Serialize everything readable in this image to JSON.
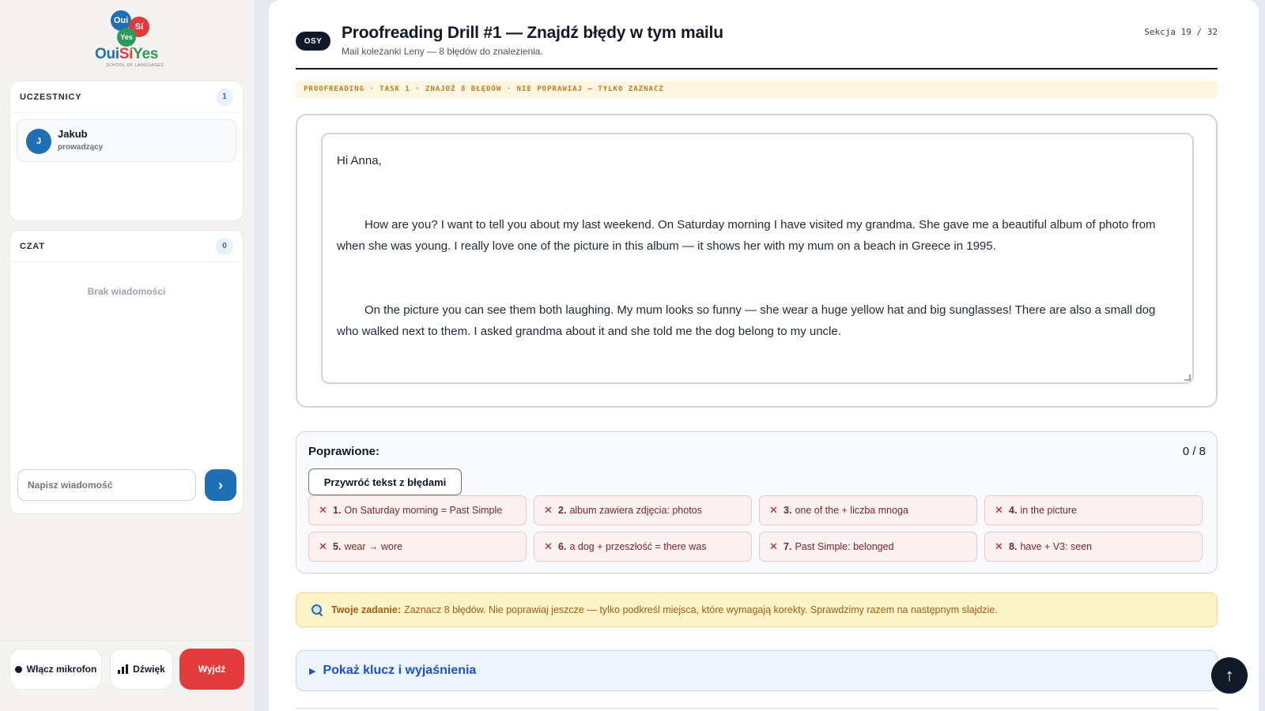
{
  "brand": {
    "bubble1": "Oui",
    "bubble2": "Sí",
    "bubble3": "Yes",
    "word_oui": "Oui",
    "word_si": "Sí",
    "word_yes": "Yes",
    "tagline": "SCHOOL OF LANGUAGES"
  },
  "participants": {
    "title": "UCZESTNICY",
    "count": "1",
    "items": [
      {
        "initial": "J",
        "name": "Jakub",
        "role": "prowadzący"
      }
    ]
  },
  "chat": {
    "title": "CZAT",
    "count": "0",
    "empty_text": "Brak wiadomości",
    "input_placeholder": "Napisz wiadomość",
    "send_icon": "chevron-right-icon",
    "send_label": "›"
  },
  "controls": {
    "mic_label": "Włącz mikrofon",
    "sound_label": "Dźwięk",
    "exit_label": "Wyjdź"
  },
  "slide": {
    "badge": "OSY",
    "title": "Proofreading Drill #1 — Znajdź błędy w tym mailu",
    "subtitle": "Mail koleżanki Leny — 8 błędów do znalezienia.",
    "section": "Sekcja 19 / 32",
    "task_strip": "PROOFREADING · TASK 1 · ZNAJDŹ 8 BŁĘDÓW · NIE POPRAWIAJ — TYLKO ZAZNACZ"
  },
  "email": {
    "greeting": "Hi Anna,",
    "paragraph1": "How are you? I want to tell you about my last weekend. On Saturday morning I have visited my grandma. She gave me a beautiful album of photo from when she was young. I really love one of the picture in this album — it shows her with my mum on a beach in Greece in 1995.",
    "paragraph2": "On the picture you can see them both laughing. My mum looks so funny — she wear a huge yellow hat and big sunglasses! There are also a small dog who walked next to them. I asked grandma about it and she told me the dog belong to my uncle."
  },
  "corrections": {
    "label": "Poprawione:",
    "score": "0 / 8",
    "restore_label": "Przywróć tekst z błędami",
    "items": [
      {
        "num": "1.",
        "text": "On Saturday morning = Past Simple"
      },
      {
        "num": "2.",
        "text": "album zawiera zdjęcia: photos"
      },
      {
        "num": "3.",
        "text": "one of the + liczba mnoga"
      },
      {
        "num": "4.",
        "text": "in the picture"
      },
      {
        "num": "5.",
        "text": "wear → wore"
      },
      {
        "num": "6.",
        "text": "a dog + przeszłość = there was"
      },
      {
        "num": "7.",
        "text": "Past Simple: belonged"
      },
      {
        "num": "8.",
        "text": "have + V3: seen"
      }
    ]
  },
  "note": {
    "icon": "magnifier-icon",
    "bold": "Twoje zadanie:",
    "text": "Zaznacz 8 błędów. Nie poprawiaj jeszcze — tylko podkreśl miejsca, które wymagają korekty. Sprawdzimy razem na następnym slajdzie."
  },
  "key": {
    "label": "Pokaż klucz i wyjaśnienia"
  },
  "fab": {
    "icon": "arrow-up-icon",
    "label": "↑"
  },
  "colors": {
    "accent": "#1f6fb5",
    "danger": "#e23b3b",
    "note_bg": "#fdf3c9",
    "chip_bg": "#fdf2f2"
  }
}
